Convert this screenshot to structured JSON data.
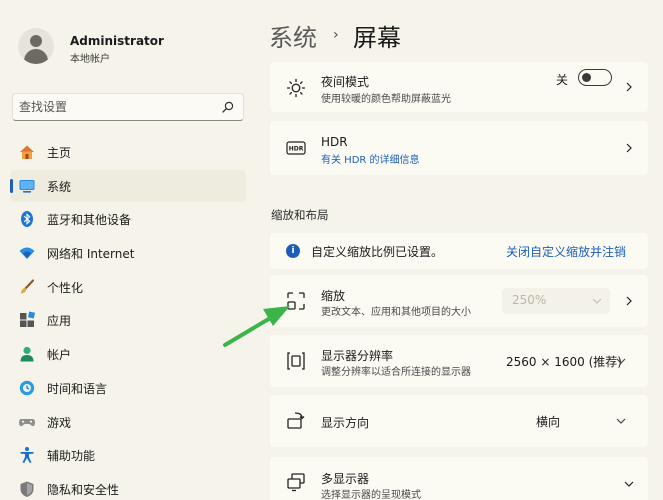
{
  "user": {
    "name": "Administrator",
    "account_type": "本地帐户"
  },
  "search": {
    "placeholder": "查找设置"
  },
  "nav": {
    "items": [
      {
        "label": "主页",
        "icon": "home-icon"
      },
      {
        "label": "系统",
        "icon": "system-icon",
        "active": true
      },
      {
        "label": "蓝牙和其他设备",
        "icon": "bluetooth-icon"
      },
      {
        "label": "网络和 Internet",
        "icon": "wifi-icon"
      },
      {
        "label": "个性化",
        "icon": "brush-icon"
      },
      {
        "label": "应用",
        "icon": "apps-icon"
      },
      {
        "label": "帐户",
        "icon": "account-icon"
      },
      {
        "label": "时间和语言",
        "icon": "globe-clock-icon"
      },
      {
        "label": "游戏",
        "icon": "gamepad-icon"
      },
      {
        "label": "辅助功能",
        "icon": "accessibility-icon"
      },
      {
        "label": "隐私和安全性",
        "icon": "shield-icon"
      }
    ]
  },
  "breadcrumb": {
    "parent": "系统",
    "separator": "›",
    "current": "屏幕"
  },
  "night_light": {
    "title": "夜间模式",
    "subtitle": "使用较暖的颜色帮助屏蔽蓝光",
    "state_label": "关",
    "enabled": false
  },
  "hdr": {
    "title": "HDR",
    "subtitle": "有关 HDR 的详细信息",
    "icon_text": "HDR"
  },
  "section": {
    "scale_layout": "缩放和布局"
  },
  "info_bar": {
    "message": "自定义缩放比例已设置。",
    "link": "关闭自定义缩放并注销"
  },
  "scale": {
    "title": "缩放",
    "subtitle": "更改文本、应用和其他项目的大小",
    "value": "250%",
    "disabled": true
  },
  "resolution": {
    "title": "显示器分辨率",
    "subtitle": "调整分辨率以适合所连接的显示器",
    "value": "2560 × 1600 (推荐)"
  },
  "orientation": {
    "title": "显示方向",
    "value": "横向"
  },
  "multi_display": {
    "title": "多显示器",
    "subtitle": "选择显示器的呈现模式"
  },
  "colors": {
    "accent": "#1d5fb8",
    "background": "#f6f4ea",
    "card": "#fbfaf3",
    "annotation_arrow": "#3bb54a"
  }
}
